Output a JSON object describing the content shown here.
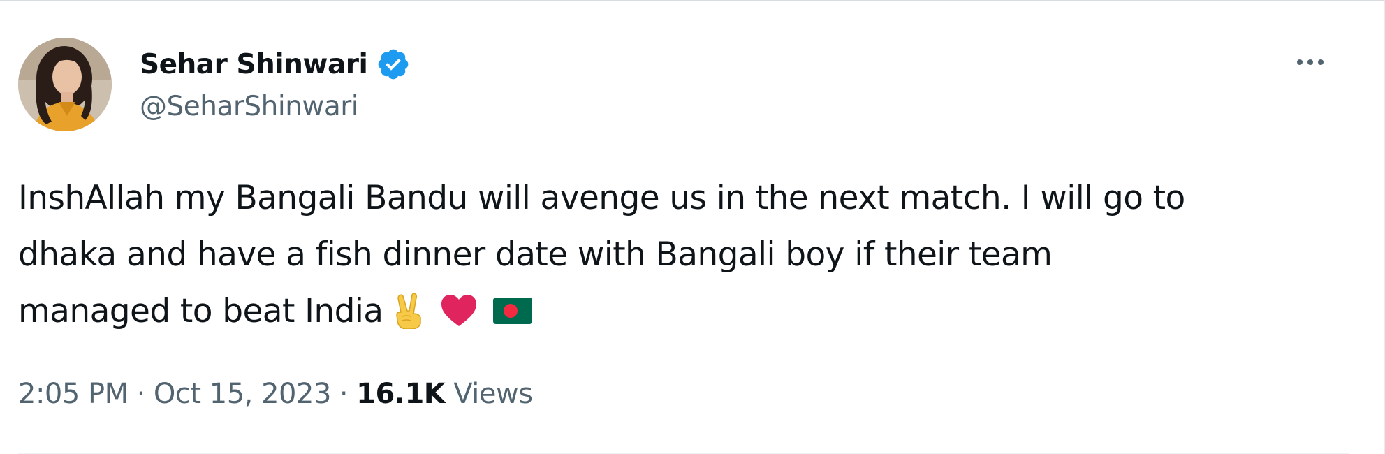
{
  "author": {
    "display_name": "Sehar Shinwari",
    "handle": "@SeharShinwari",
    "avatar_icon": "profile-photo",
    "verified_icon": "verified-badge-icon",
    "verified_color": "#1d9bf0"
  },
  "more_icon": "more-options-icon",
  "tweet": {
    "lines": [
      "InshAllah my Bangali Bandu will avenge us in the next match. I will go to",
      "dhaka and have a fish dinner date with Bangali boy if their team",
      "managed to beat India"
    ],
    "emojis": [
      "victory-hand-emoji",
      "red-heart-emoji",
      "bangladesh-flag-emoji"
    ]
  },
  "meta": {
    "time": "2:05 PM",
    "separator": "·",
    "date": "Oct 15, 2023",
    "views_count": "16.1K",
    "views_label": "Views"
  },
  "colors": {
    "text_primary": "#0f1419",
    "text_secondary": "#536471",
    "heart": "#e0245e",
    "flag_green": "#006a4e",
    "flag_red": "#f42a41"
  }
}
